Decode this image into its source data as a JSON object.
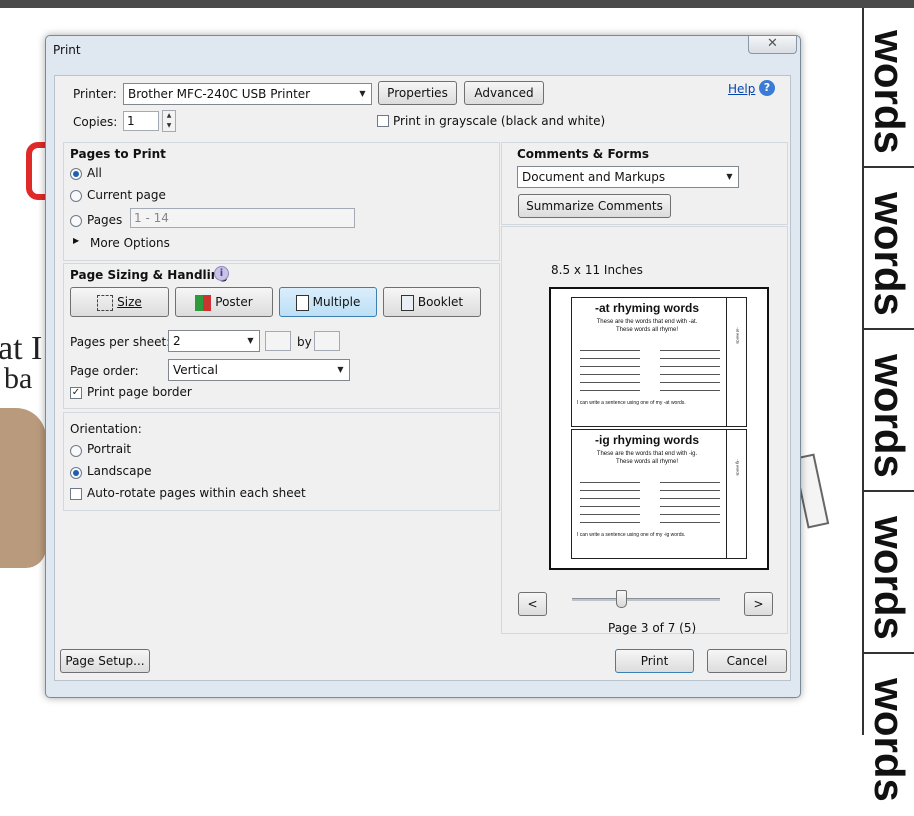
{
  "background": {
    "card_word": "words",
    "card_count": 5
  },
  "dialog": {
    "title": "Print",
    "close_glyph": "✕"
  },
  "printer": {
    "label": "Printer:",
    "value": "Brother MFC-240C USB Printer",
    "properties": "Properties",
    "advanced": "Advanced",
    "help": "Help",
    "copies_label": "Copies:",
    "copies_value": "1",
    "grayscale": "Print in grayscale (black and white)",
    "grayscale_checked": false
  },
  "pages": {
    "title": "Pages to Print",
    "all": "All",
    "current": "Current page",
    "pages": "Pages",
    "pages_value": "1 - 14",
    "more": "More Options",
    "selected": "all"
  },
  "sizing": {
    "title": "Page Sizing & Handling",
    "buttons": [
      "Size",
      "Poster",
      "Multiple",
      "Booklet"
    ],
    "active": "Multiple",
    "pps_label": "Pages per sheet:",
    "pps_value": "2",
    "by": "by",
    "order_label": "Page order:",
    "order_value": "Vertical",
    "border": "Print page border",
    "border_checked": true
  },
  "orientation": {
    "title": "Orientation:",
    "portrait": "Portrait",
    "landscape": "Landscape",
    "auto": "Auto-rotate pages within each sheet",
    "selected": "landscape"
  },
  "comments": {
    "title": "Comments & Forms",
    "value": "Document and Markups",
    "summarize": "Summarize Comments"
  },
  "preview": {
    "size": "8.5 x 11 Inches",
    "page": "Page 3 of 7 (5)",
    "prev": "<",
    "next": ">",
    "slider_fraction": 0.33,
    "sheet1": {
      "title": "-at rhyming words",
      "line1": "These are the words that end with -at.",
      "line2": "These words all rhyme!",
      "footer": "I can write a sentence using one of my -at words.",
      "tab": "-at words"
    },
    "sheet2": {
      "title": "-ig rhyming words",
      "line1": "These are the words that end with -ig.",
      "line2": "These words all rhyme!",
      "footer": "I can write a sentence using one of my -ig words.",
      "tab": "-ig words"
    }
  },
  "footer": {
    "setup": "Page Setup...",
    "print": "Print",
    "cancel": "Cancel"
  },
  "colors": {
    "accent": "#1d5fb0",
    "link": "#0645ad",
    "dialog_bg": "#dfe7f0"
  }
}
